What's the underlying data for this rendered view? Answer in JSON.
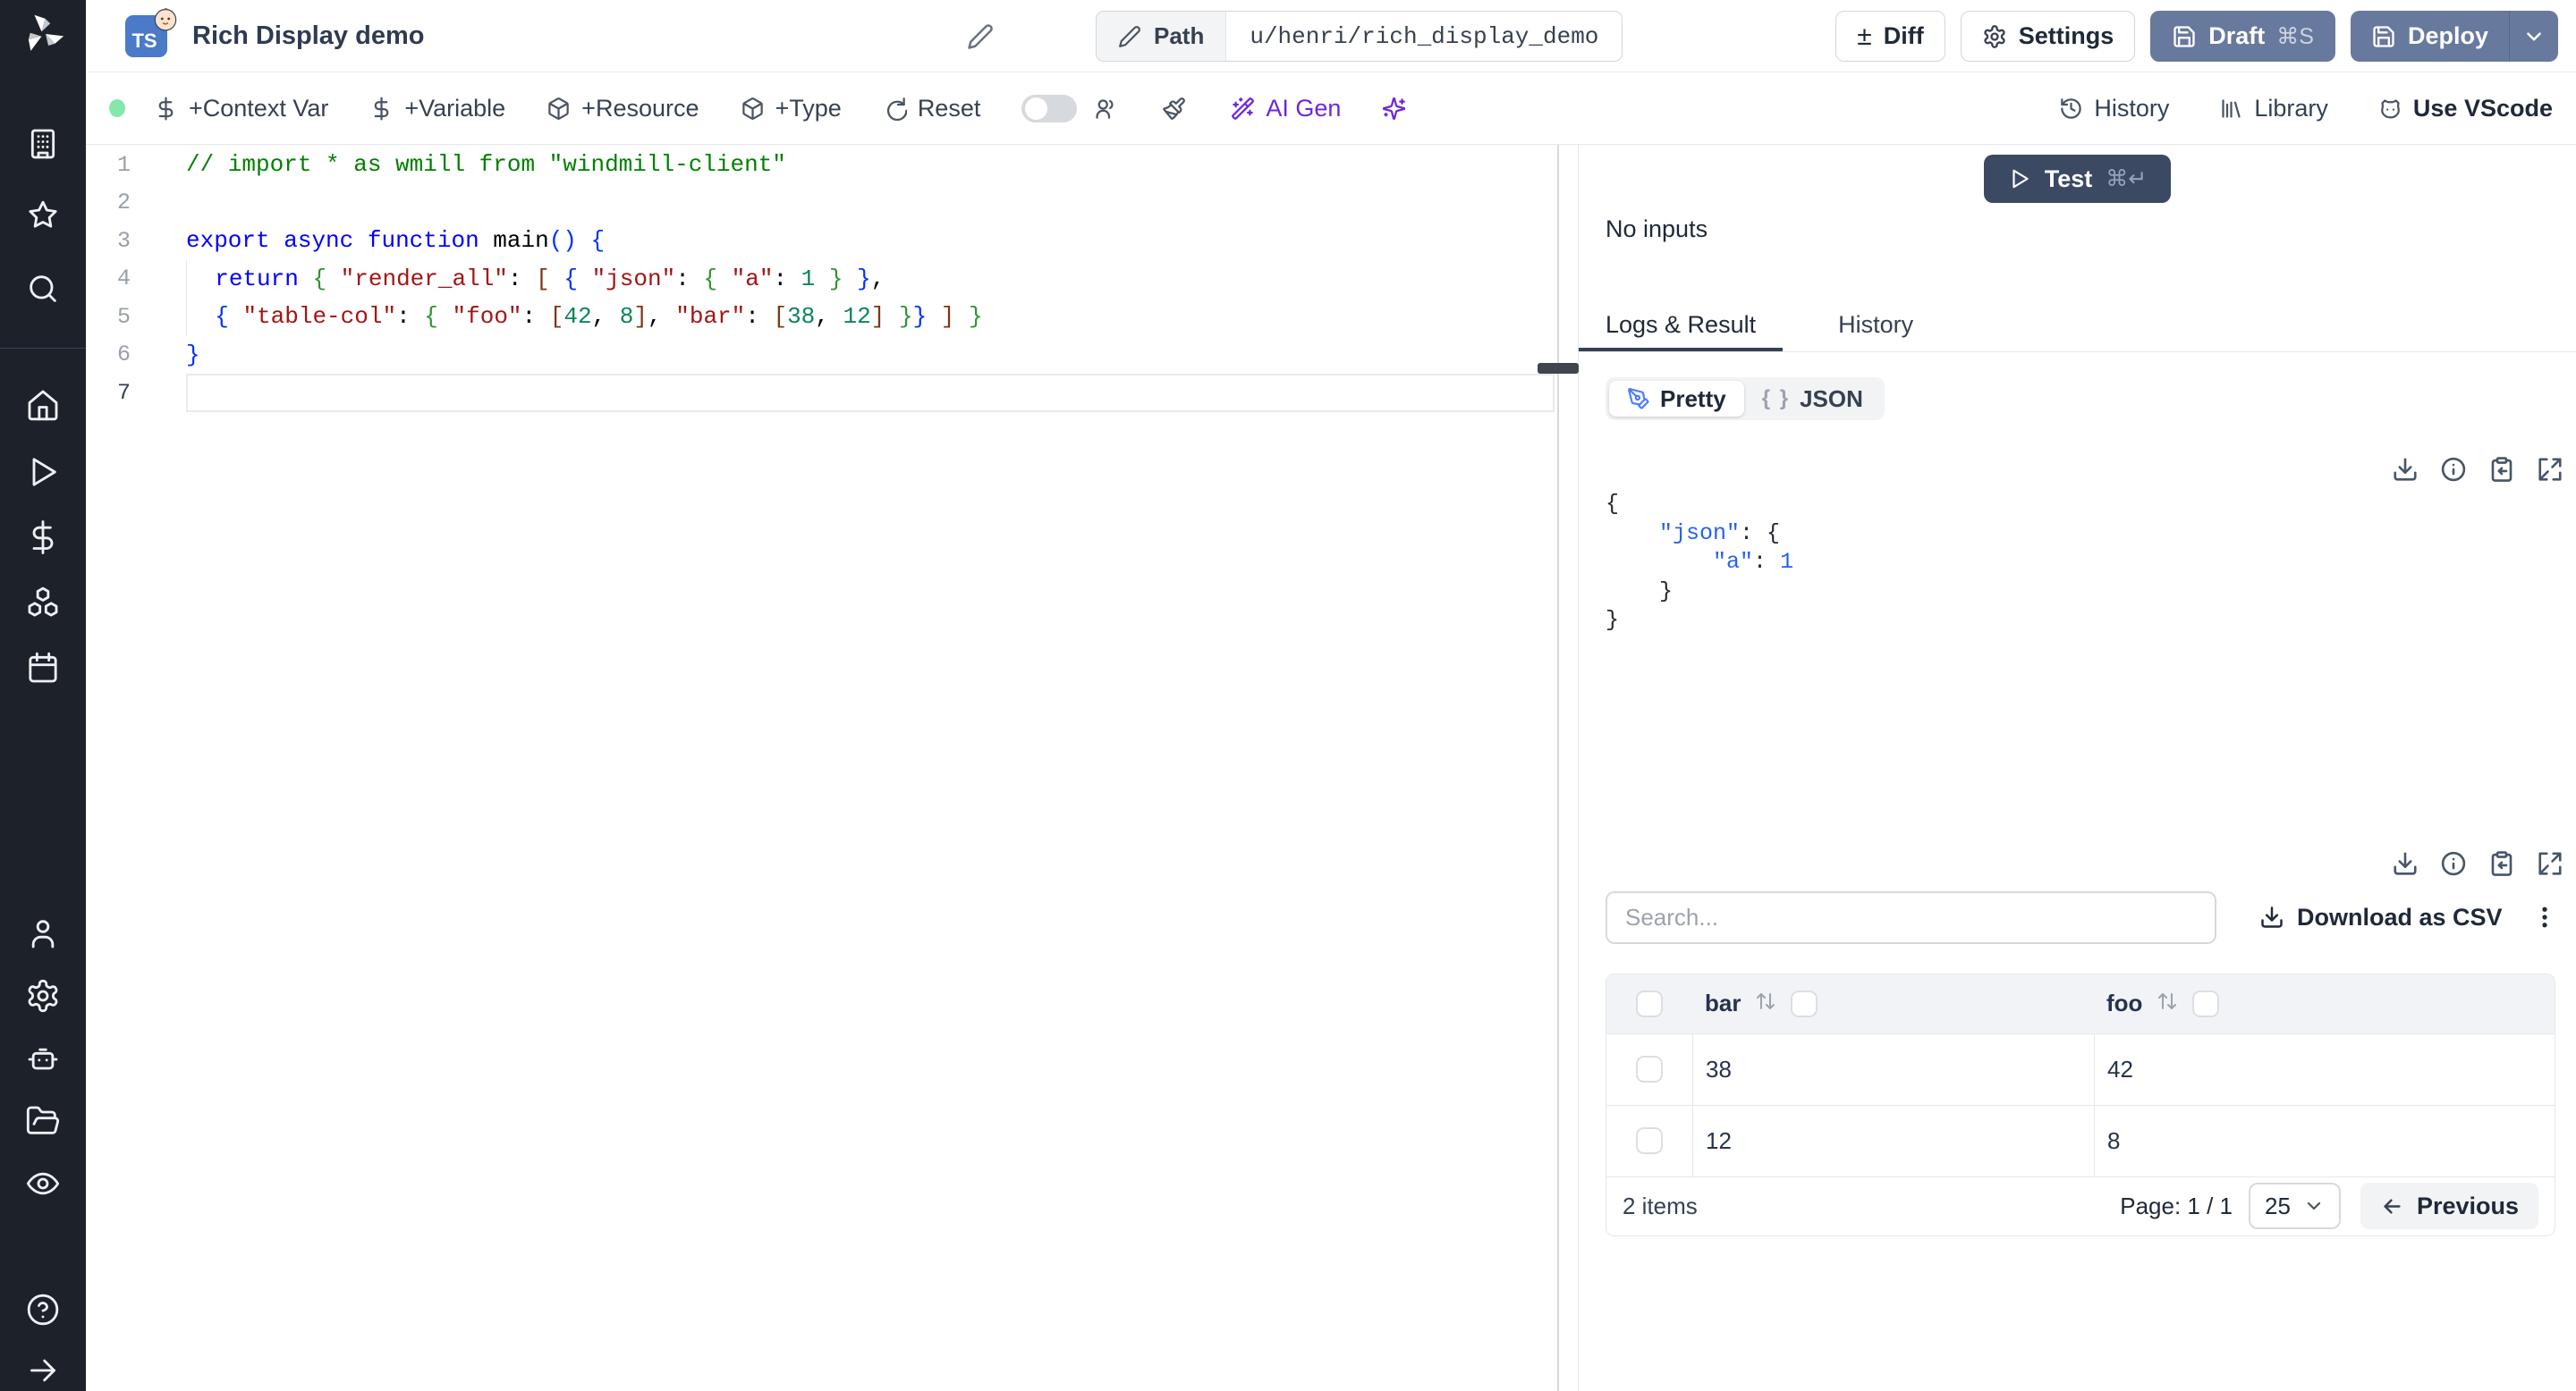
{
  "colors": {
    "rail_bg": "#1d212a",
    "primary_button": "#68799e",
    "test_button": "#3b4963",
    "ts_badge": "#4a7ac8",
    "ai_purple": "#6d28d9",
    "status_green": "#86e7ac",
    "json_key_blue": "#2563eb"
  },
  "sidebar": {
    "icons": [
      "windmill-logo",
      "building",
      "star",
      "search",
      "home",
      "play",
      "dollar",
      "boxes",
      "calendar",
      "user",
      "settings",
      "robot",
      "folder-open",
      "eye",
      "help",
      "arrow-right"
    ]
  },
  "header": {
    "language_badge": "TS",
    "title": "Rich Display demo",
    "path_button": {
      "label": "Path",
      "value": "u/henri/rich_display_demo"
    },
    "diff_label": "Diff",
    "diff_icon_glyph": "±",
    "settings_label": "Settings",
    "draft_label": "Draft",
    "draft_shortcut": "⌘S",
    "deploy_label": "Deploy"
  },
  "toolbar": {
    "context_var_label": "+Context Var",
    "variable_label": "+Variable",
    "resource_label": "+Resource",
    "type_label": "+Type",
    "reset_label": "Reset",
    "ai_gen_label": "AI Gen",
    "history_label": "History",
    "library_label": "Library",
    "vscode_label": "Use VScode"
  },
  "editor": {
    "lines": [
      {
        "n": "1",
        "tokens": [
          {
            "t": "// import * as wmill from \"windmill-client\"",
            "c": "cm"
          }
        ]
      },
      {
        "n": "2",
        "tokens": []
      },
      {
        "n": "3",
        "tokens": [
          {
            "t": "export",
            "c": "kw"
          },
          {
            "t": " "
          },
          {
            "t": "async",
            "c": "kw"
          },
          {
            "t": " "
          },
          {
            "t": "function",
            "c": "kw"
          },
          {
            "t": " main"
          },
          {
            "t": "()",
            "c": "b1"
          },
          {
            "t": " "
          },
          {
            "t": "{",
            "c": "b1"
          }
        ]
      },
      {
        "n": "4",
        "guide": true,
        "tokens": [
          {
            "t": "  "
          },
          {
            "t": "return",
            "c": "kw"
          },
          {
            "t": " "
          },
          {
            "t": "{",
            "c": "b2"
          },
          {
            "t": " "
          },
          {
            "t": "\"render_all\"",
            "c": "str"
          },
          {
            "t": ": "
          },
          {
            "t": "[",
            "c": "b3"
          },
          {
            "t": " "
          },
          {
            "t": "{",
            "c": "b1"
          },
          {
            "t": " "
          },
          {
            "t": "\"json\"",
            "c": "str"
          },
          {
            "t": ": "
          },
          {
            "t": "{",
            "c": "b2"
          },
          {
            "t": " "
          },
          {
            "t": "\"a\"",
            "c": "str"
          },
          {
            "t": ": "
          },
          {
            "t": "1",
            "c": "num"
          },
          {
            "t": " "
          },
          {
            "t": "}",
            "c": "b2"
          },
          {
            "t": " "
          },
          {
            "t": "}",
            "c": "b1"
          },
          {
            "t": ","
          }
        ]
      },
      {
        "n": "5",
        "guide": true,
        "tokens": [
          {
            "t": "  "
          },
          {
            "t": "{",
            "c": "b1"
          },
          {
            "t": " "
          },
          {
            "t": "\"table-col\"",
            "c": "str"
          },
          {
            "t": ": "
          },
          {
            "t": "{",
            "c": "b2"
          },
          {
            "t": " "
          },
          {
            "t": "\"foo\"",
            "c": "str"
          },
          {
            "t": ": "
          },
          {
            "t": "[",
            "c": "b3"
          },
          {
            "t": "42",
            "c": "num"
          },
          {
            "t": ", "
          },
          {
            "t": "8",
            "c": "num"
          },
          {
            "t": "]",
            "c": "b3"
          },
          {
            "t": ", "
          },
          {
            "t": "\"bar\"",
            "c": "str"
          },
          {
            "t": ": "
          },
          {
            "t": "[",
            "c": "b3"
          },
          {
            "t": "38",
            "c": "num"
          },
          {
            "t": ", "
          },
          {
            "t": "12",
            "c": "num"
          },
          {
            "t": "]",
            "c": "b3"
          },
          {
            "t": " "
          },
          {
            "t": "}",
            "c": "b2"
          },
          {
            "t": "}",
            "c": "b1"
          },
          {
            "t": " "
          },
          {
            "t": "]",
            "c": "b3"
          },
          {
            "t": " "
          },
          {
            "t": "}",
            "c": "b2"
          }
        ]
      },
      {
        "n": "6",
        "tokens": [
          {
            "t": "}",
            "c": "b1"
          }
        ]
      },
      {
        "n": "7",
        "active": true,
        "tokens": []
      }
    ]
  },
  "run_panel": {
    "test_label": "Test",
    "test_shortcut": "⌘↵",
    "no_inputs_label": "No inputs",
    "tabs": [
      {
        "label": "Logs & Result",
        "active": true
      },
      {
        "label": "History",
        "active": false
      }
    ],
    "view_modes": [
      {
        "label": "Pretty",
        "active": true
      },
      {
        "label": "JSON",
        "active": false,
        "icon_glyph": "{ }"
      }
    ],
    "result_lines": [
      [
        {
          "t": "{"
        }
      ],
      [
        {
          "t": "    "
        },
        {
          "t": "\"json\"",
          "c": "key"
        },
        {
          "t": ": {"
        }
      ],
      [
        {
          "t": "        "
        },
        {
          "t": "\"a\"",
          "c": "key"
        },
        {
          "t": ": "
        },
        {
          "t": "1",
          "c": "val"
        }
      ],
      [
        {
          "t": "    }"
        }
      ],
      [
        {
          "t": "}"
        }
      ]
    ],
    "search_placeholder": "Search...",
    "download_csv_label": "Download as CSV",
    "table": {
      "columns": [
        "bar",
        "foo"
      ],
      "rows": [
        [
          "38",
          "42"
        ],
        [
          "12",
          "8"
        ]
      ],
      "items_label": "2 items",
      "page_label": "Page: 1 / 1",
      "page_size": "25",
      "previous_label": "Previous"
    }
  }
}
